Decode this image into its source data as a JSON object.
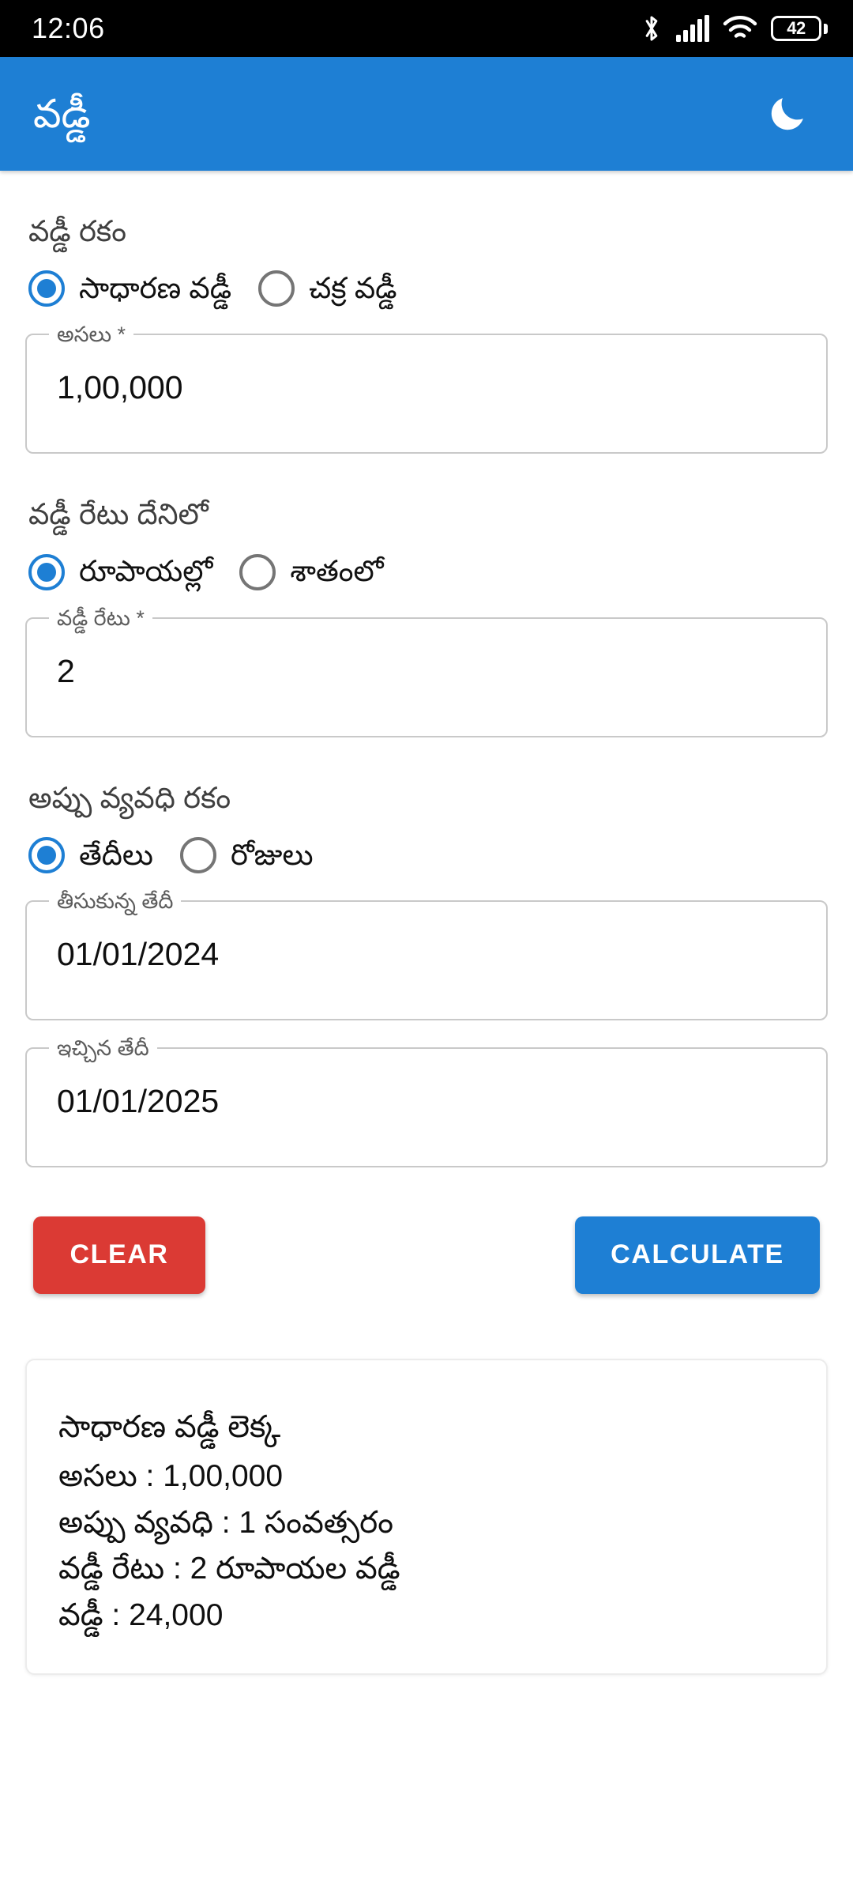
{
  "status_bar": {
    "clock": "12:06",
    "battery_level": "42",
    "icons": [
      "bluetooth-icon",
      "cellular-signal-icon",
      "wifi-icon",
      "battery-icon"
    ]
  },
  "app_bar": {
    "title": "వడ్డీ",
    "action_icon": "moon-icon",
    "background_color": "#1E7FD4"
  },
  "form": {
    "interest_type": {
      "label": "వడ్డీ రకం",
      "options": [
        {
          "label": "సాధారణ వడ్డీ",
          "selected": true
        },
        {
          "label": "చక్ర వడ్డీ",
          "selected": false
        }
      ]
    },
    "principal": {
      "label": "అసలు *",
      "value": "1,00,000"
    },
    "rate_unit": {
      "label": "వడ్డీ రేటు దేనిలో",
      "options": [
        {
          "label": "రూపాయల్లో",
          "selected": true
        },
        {
          "label": "శాతంలో",
          "selected": false
        }
      ]
    },
    "rate": {
      "label": "వడ్డీ రేటు *",
      "value": "2"
    },
    "duration_type": {
      "label": "అప్పు వ్యవధి రకం",
      "options": [
        {
          "label": "తేదీలు",
          "selected": true
        },
        {
          "label": "రోజులు",
          "selected": false
        }
      ]
    },
    "from_date": {
      "label": "తీసుకున్న తేదీ",
      "value": "01/01/2024"
    },
    "to_date": {
      "label": "ఇచ్చిన తేదీ",
      "value": "01/01/2025"
    }
  },
  "buttons": {
    "clear": {
      "label": "CLEAR",
      "color": "#DB3A34"
    },
    "calculate": {
      "label": "CALCULATE",
      "color": "#1E7FD4"
    }
  },
  "result": {
    "title": "సాధారణ వడ్డీ లెక్క",
    "lines": [
      "అసలు : 1,00,000",
      "అప్పు వ్యవధి : 1 సంవత్సరం",
      "వడ్డీ రేటు : 2 రూపాయల వడ్డీ",
      "వడ్డీ : 24,000"
    ]
  }
}
